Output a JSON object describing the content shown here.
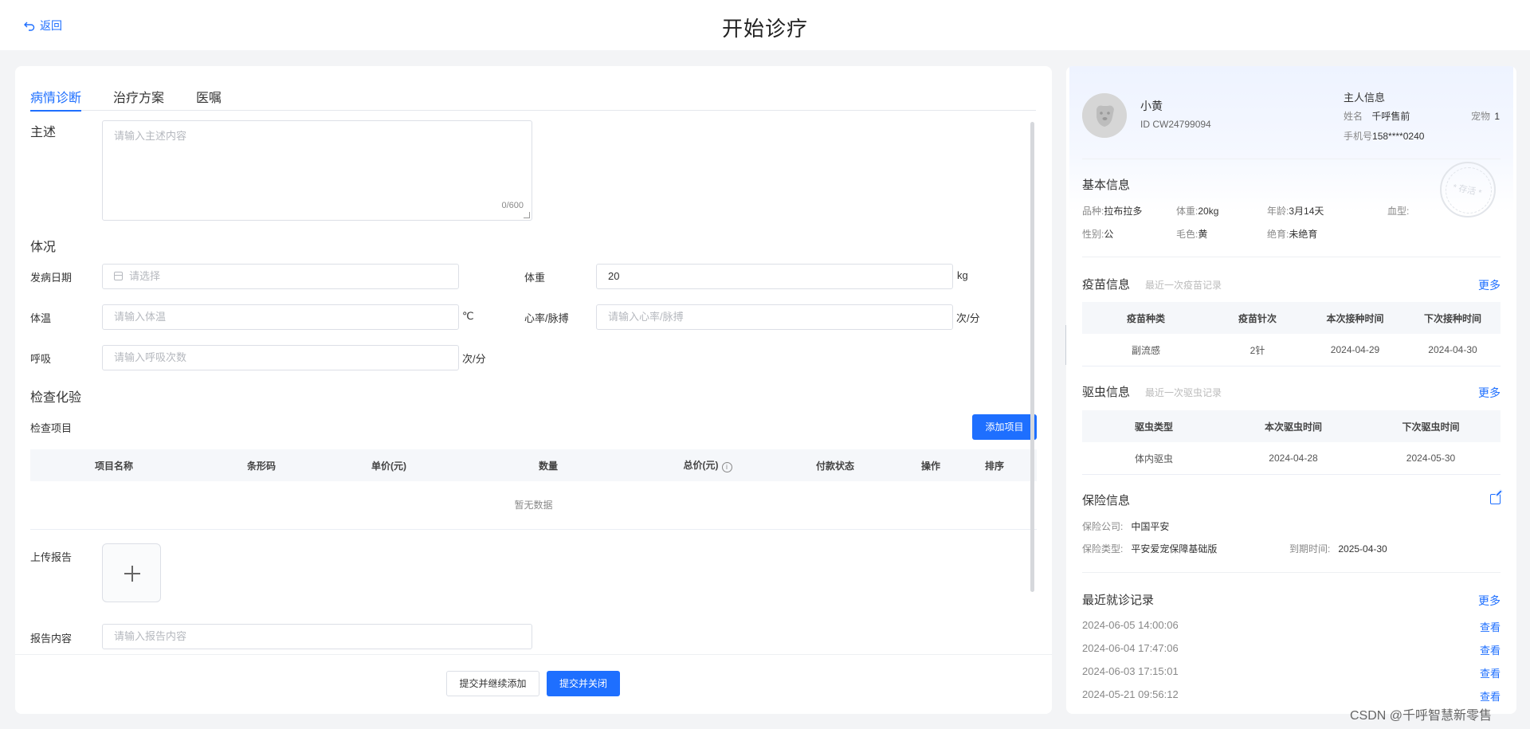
{
  "header": {
    "back_label": "返回",
    "title": "开始诊疗"
  },
  "tabs": [
    {
      "label": "病情诊断",
      "active": true
    },
    {
      "label": "治疗方案",
      "active": false
    },
    {
      "label": "医嘱",
      "active": false
    }
  ],
  "diagnosis": {
    "chief_complaint_label": "主述",
    "chief_complaint_placeholder": "请输入主述内容",
    "chief_complaint_count": "0/600",
    "condition_label": "体况",
    "onset_date_label": "发病日期",
    "onset_date_placeholder": "请选择",
    "weight_label": "体重",
    "weight_value": "20",
    "weight_unit": "kg",
    "temperature_label": "体温",
    "temperature_placeholder": "请输入体温",
    "temperature_unit": "℃",
    "heart_rate_label": "心率/脉搏",
    "heart_rate_placeholder": "请输入心率/脉搏",
    "heart_rate_unit": "次/分",
    "breath_label": "呼吸",
    "breath_placeholder": "请输入呼吸次数",
    "breath_unit": "次/分",
    "exam_section_label": "检查化验",
    "exam_items_label": "检查项目",
    "add_item_button": "添加项目",
    "exam_table_columns": [
      "项目名称",
      "条形码",
      "单价(元)",
      "数量",
      "总价(元)",
      "付款状态",
      "操作",
      "排序"
    ],
    "exam_table_empty": "暂无数据",
    "upload_report_label": "上传报告",
    "report_content_label": "报告内容",
    "report_content_placeholder": "请输入报告内容"
  },
  "footer": {
    "submit_continue_label": "提交并继续添加",
    "submit_close_label": "提交并关闭"
  },
  "pet": {
    "name": "小黄",
    "id_text": "ID CW24799094",
    "owner_section": "主人信息",
    "owner_name_label": "姓名",
    "owner_name": "千呼售前",
    "pet_count_label": "宠物",
    "pet_count": "1",
    "phone_label": "手机号",
    "phone": "158****0240",
    "stamp_text": "* 存活 *"
  },
  "basic_info": {
    "title": "基本信息",
    "breed_label": "品种:",
    "breed": "拉布拉多",
    "weight_label": "体重:",
    "weight": "20kg",
    "age_label": "年龄:",
    "age": "3月14天",
    "blood_label": "血型:",
    "blood": "",
    "gender_label": "性别:",
    "gender": "公",
    "color_label": "毛色:",
    "color": "黄",
    "sterile_label": "绝育:",
    "sterile": "未绝育"
  },
  "vaccine": {
    "title": "疫苗信息",
    "subtitle": "最近一次疫苗记录",
    "more": "更多",
    "columns": [
      "疫苗种类",
      "疫苗针次",
      "本次接种时间",
      "下次接种时间"
    ],
    "rows": [
      [
        "副流感",
        "2针",
        "2024-04-29",
        "2024-04-30"
      ]
    ]
  },
  "deworm": {
    "title": "驱虫信息",
    "subtitle": "最近一次驱虫记录",
    "more": "更多",
    "columns": [
      "驱虫类型",
      "本次驱虫时间",
      "下次驱虫时间"
    ],
    "rows": [
      [
        "体内驱虫",
        "2024-04-28",
        "2024-05-30"
      ]
    ]
  },
  "insurance": {
    "title": "保险信息",
    "company_label": "保险公司:",
    "company": "中国平安",
    "type_label": "保险类型:",
    "type": "平安爱宠保障基础版",
    "expire_label": "到期时间:",
    "expire": "2025-04-30"
  },
  "records": {
    "title": "最近就诊记录",
    "more": "更多",
    "view_label": "查看",
    "items": [
      "2024-06-05 14:00:06",
      "2024-06-04 17:47:06",
      "2024-06-03 17:15:01",
      "2024-05-21 09:56:12"
    ]
  },
  "watermark": "CSDN @千呼智慧新零售",
  "colors": {
    "accent": "#1e6fff",
    "background": "#f3f4f6"
  }
}
